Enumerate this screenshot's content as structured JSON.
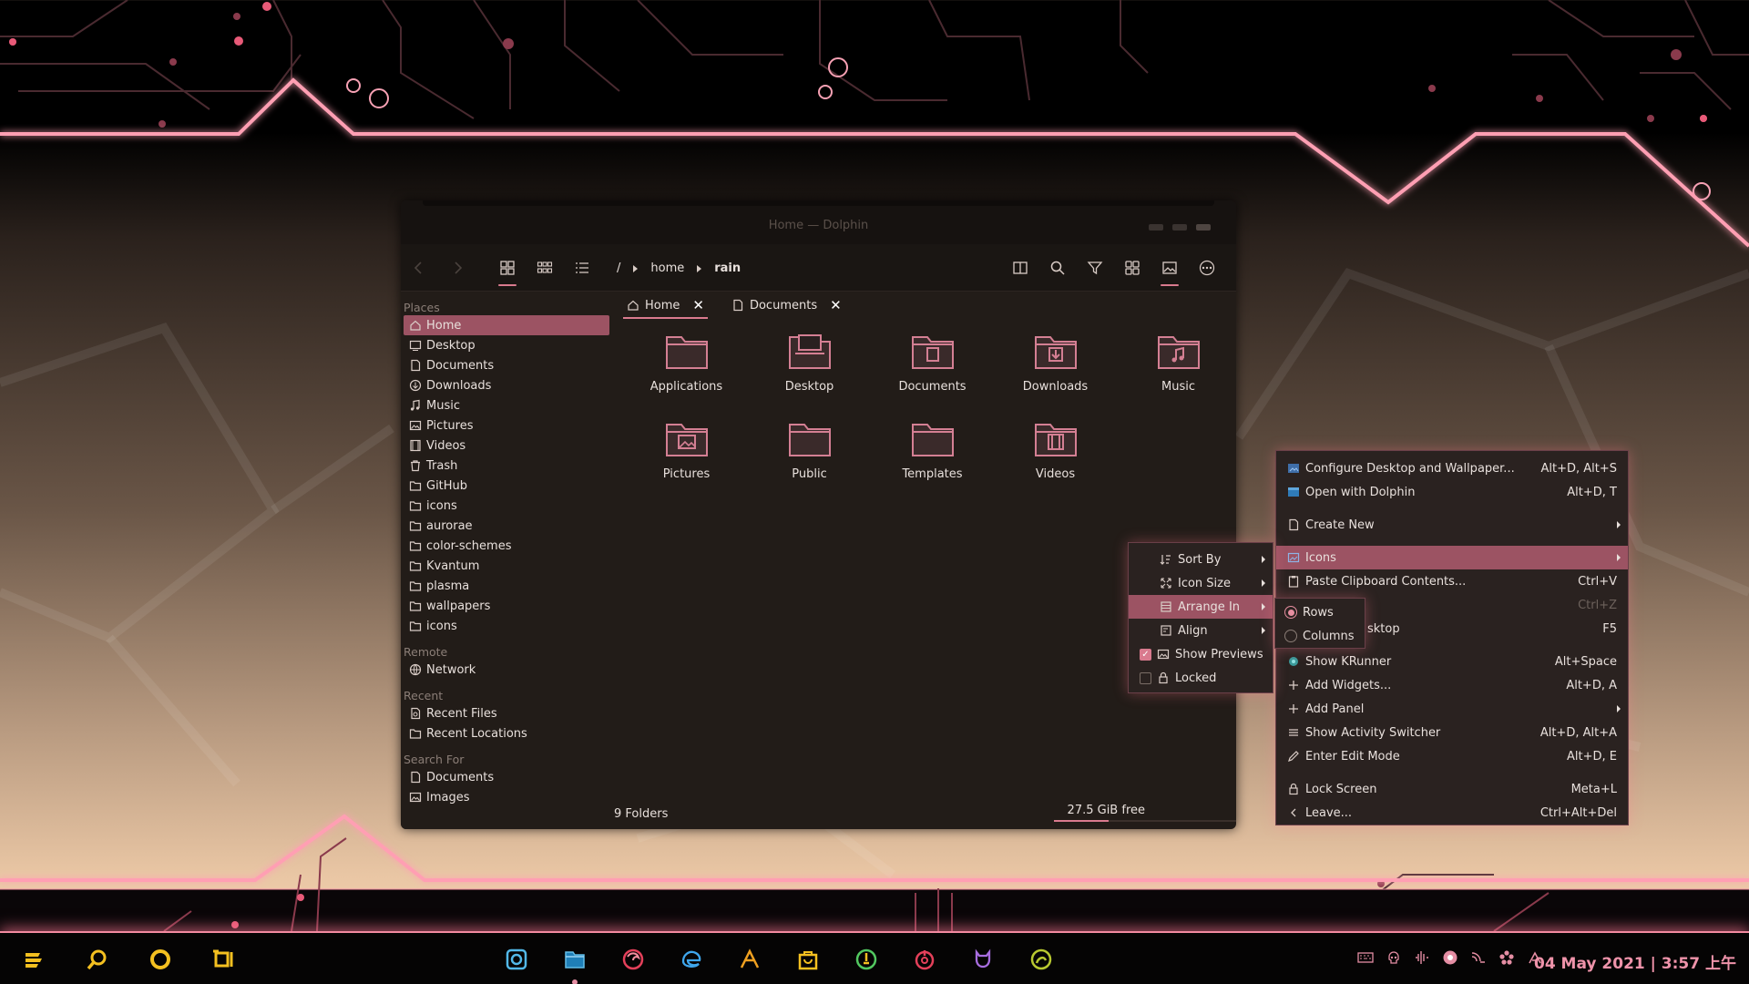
{
  "window": {
    "title": "Home — Dolphin",
    "breadcrumb": [
      "/",
      "home",
      "rain"
    ],
    "tabs": [
      {
        "label": "Home",
        "active": true
      },
      {
        "label": "Documents",
        "active": false
      }
    ],
    "places_title": "Places",
    "places": [
      "Home",
      "Desktop",
      "Documents",
      "Downloads",
      "Music",
      "Pictures",
      "Videos",
      "Trash",
      "GitHub",
      "icons",
      "aurorae",
      "color-schemes",
      "Kvantum",
      "plasma",
      "wallpapers",
      "icons"
    ],
    "remote_title": "Remote",
    "remote": [
      "Network"
    ],
    "recent_title": "Recent",
    "recent": [
      "Recent Files",
      "Recent Locations"
    ],
    "search_title": "Search For",
    "search": [
      "Documents",
      "Images"
    ],
    "folders": [
      "Applications",
      "Desktop",
      "Documents",
      "Downloads",
      "Music",
      "Pictures",
      "Public",
      "Templates",
      "Videos"
    ],
    "status_left": "9 Folders",
    "status_free": "27.5 GiB free",
    "disk_used_fraction": 0.3
  },
  "desktop_menu": {
    "items": [
      {
        "label": "Configure Desktop and Wallpaper...",
        "shortcut": "Alt+D, Alt+S"
      },
      {
        "label": "Open with Dolphin",
        "shortcut": "Alt+D, T"
      },
      {
        "label": "Create New",
        "shortcut": ""
      },
      {
        "label": "Icons",
        "shortcut": ""
      },
      {
        "label": "Paste Clipboard Contents...",
        "shortcut": "Ctrl+V"
      },
      {
        "label": "",
        "shortcut": "Ctrl+Z"
      },
      {
        "label": "sktop",
        "shortcut": "F5"
      },
      {
        "label": "Show KRunner",
        "shortcut": "Alt+Space"
      },
      {
        "label": "Add Widgets...",
        "shortcut": "Alt+D, A"
      },
      {
        "label": "Add Panel",
        "shortcut": ""
      },
      {
        "label": "Show Activity Switcher",
        "shortcut": "Alt+D, Alt+A"
      },
      {
        "label": "Enter Edit Mode",
        "shortcut": "Alt+D, E"
      },
      {
        "label": "Lock Screen",
        "shortcut": "Meta+L"
      },
      {
        "label": "Leave...",
        "shortcut": "Ctrl+Alt+Del"
      }
    ]
  },
  "icons_menu": {
    "items": [
      "Sort By",
      "Icon Size",
      "Arrange In",
      "Align",
      "Show Previews",
      "Locked"
    ],
    "show_previews_checked": true,
    "locked_checked": false
  },
  "arrange_menu": {
    "items": [
      "Rows",
      "Columns"
    ],
    "selected": "Rows"
  },
  "taskbar": {
    "clock": "04 May 2021 | 3:57 上午"
  },
  "colors": {
    "accent": "#d97a8e",
    "highlight": "#9c5363",
    "neon": "#f28aa0"
  }
}
